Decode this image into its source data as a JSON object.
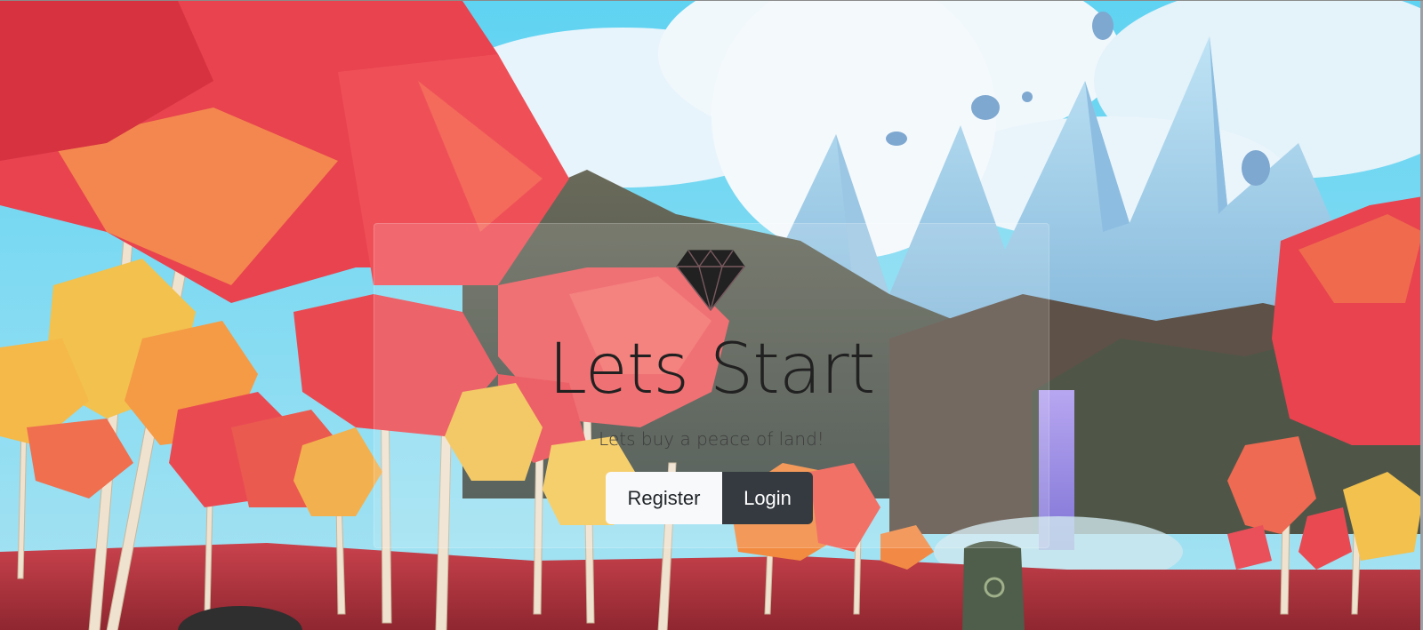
{
  "hero": {
    "title": "Lets Start",
    "subtitle": "Lets buy a peace of land!",
    "icon": "diamond-icon"
  },
  "actions": {
    "register_label": "Register",
    "login_label": "Login"
  },
  "colors": {
    "title": "#212121",
    "register_bg": "#f8f9fa",
    "login_bg": "#343a40",
    "sky": "#5fd0ef",
    "foliage_red": "#e8434f",
    "foliage_orange": "#f59a45",
    "foliage_yellow": "#f2c14e"
  }
}
